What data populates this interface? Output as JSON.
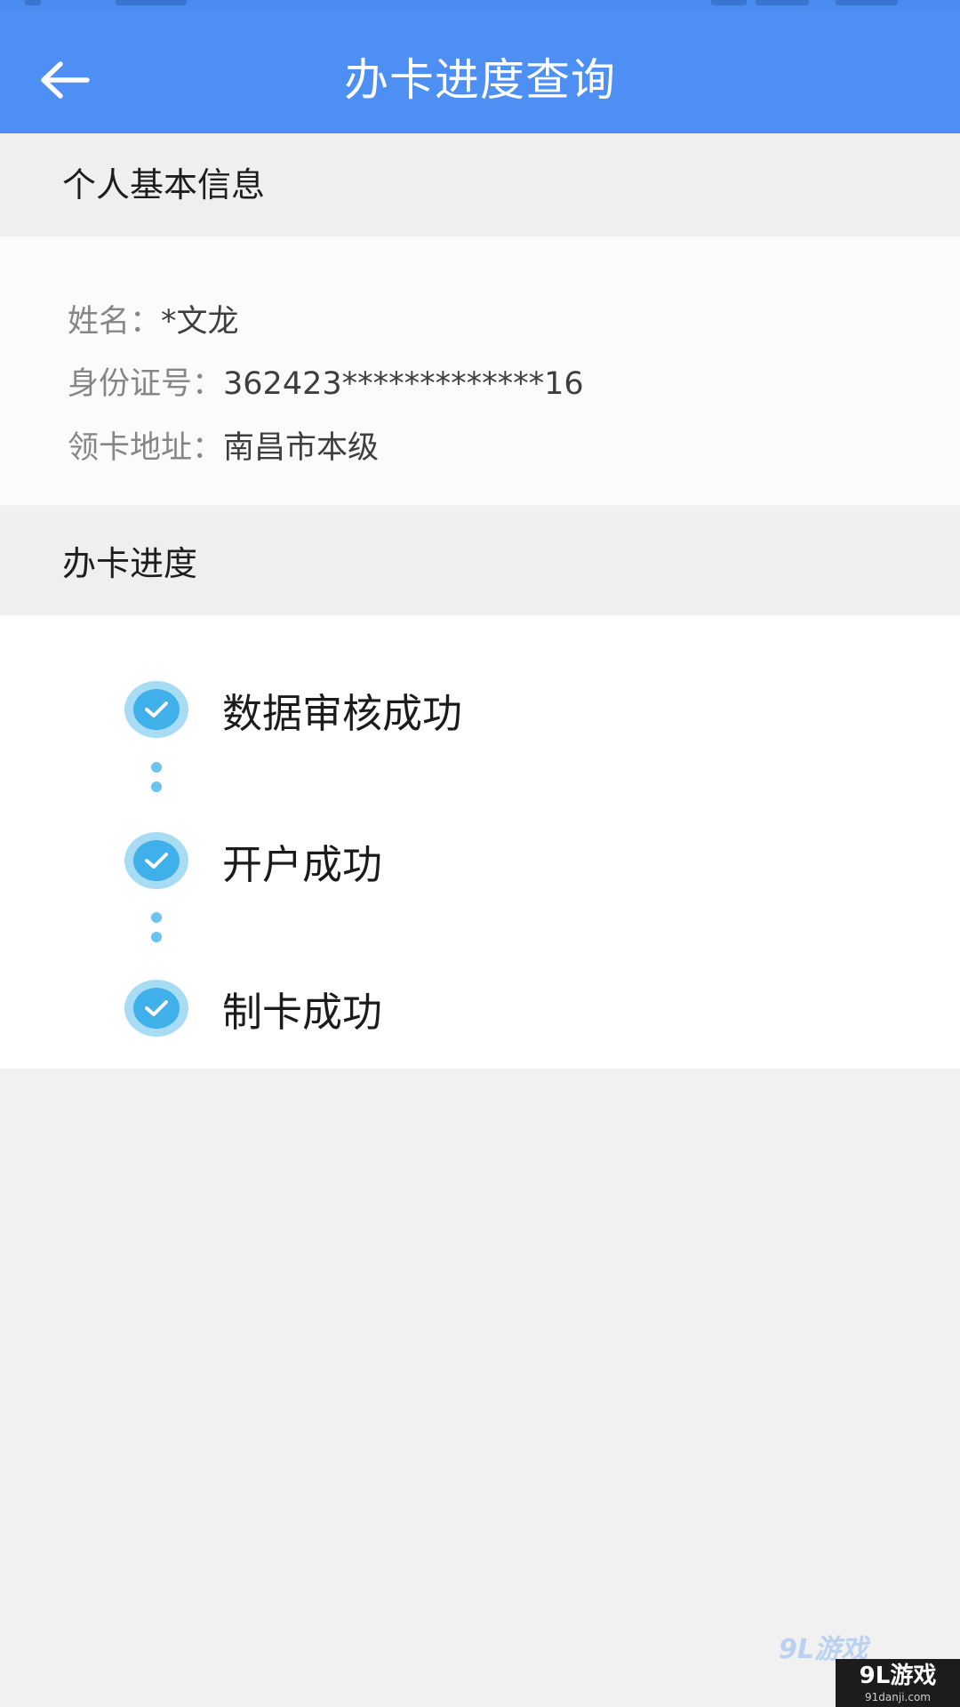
{
  "header": {
    "title": "办卡进度查询",
    "back_icon": "arrow-left-icon"
  },
  "personal_info": {
    "section_title": "个人基本信息",
    "rows": [
      {
        "label": "姓名：",
        "value": "*文龙"
      },
      {
        "label": "身份证号：",
        "value": "362423*************16"
      },
      {
        "label": "领卡地址：",
        "value": "南昌市本级"
      }
    ]
  },
  "progress": {
    "section_title": "办卡进度",
    "steps": [
      {
        "label": "数据审核成功",
        "status": "done",
        "icon": "check-circle-icon"
      },
      {
        "label": "开户成功",
        "status": "done",
        "icon": "check-circle-icon"
      },
      {
        "label": "制卡成功",
        "status": "done",
        "icon": "check-circle-icon"
      }
    ]
  },
  "watermark": {
    "text": "9L游戏",
    "sub": "91danji.com"
  },
  "colors": {
    "header_bg": "#4d8ff3",
    "check_fill": "#3fb0ea",
    "check_halo": "#a8dcf5",
    "connector": "#6bc3ef",
    "page_bg": "#f0f1f0"
  }
}
